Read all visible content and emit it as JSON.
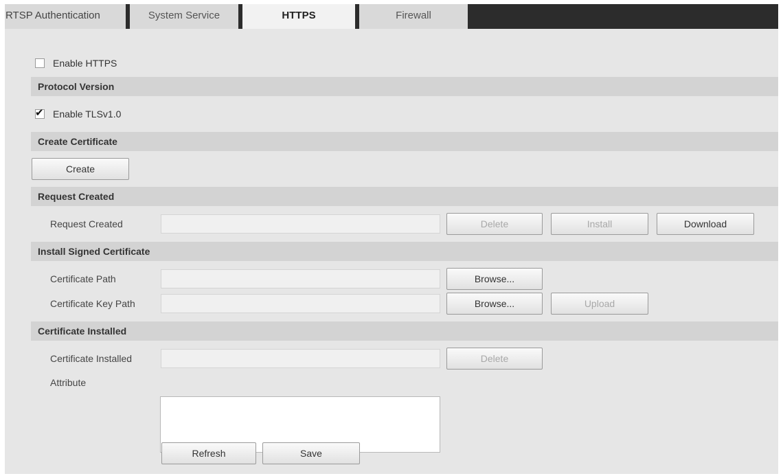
{
  "tabs": [
    {
      "label": "RTSP Authentication",
      "active": false
    },
    {
      "label": "System Service",
      "active": false
    },
    {
      "label": "HTTPS",
      "active": true
    },
    {
      "label": "Firewall",
      "active": false
    }
  ],
  "enable_https": {
    "label": "Enable HTTPS",
    "checked": false
  },
  "protocol_version": {
    "title": "Protocol Version",
    "tls": {
      "label": "Enable TLSv1.0",
      "checked": true
    }
  },
  "create_certificate": {
    "title": "Create Certificate",
    "create_label": "Create"
  },
  "request_created": {
    "title": "Request Created",
    "row_label": "Request Created",
    "value": "",
    "delete_label": "Delete",
    "install_label": "Install",
    "download_label": "Download"
  },
  "install_signed": {
    "title": "Install Signed Certificate",
    "cert_path_label": "Certificate Path",
    "cert_path_value": "",
    "cert_key_path_label": "Certificate Key Path",
    "cert_key_path_value": "",
    "browse_label": "Browse...",
    "upload_label": "Upload"
  },
  "cert_installed": {
    "title": "Certificate Installed",
    "row_label": "Certificate Installed",
    "value": "",
    "delete_label": "Delete",
    "attribute_label": "Attribute",
    "attribute_value": ""
  },
  "footer": {
    "refresh_label": "Refresh",
    "save_label": "Save"
  },
  "colors": {
    "tabbar": "#2c2c2c",
    "panel": "#e6e6e6",
    "section_header": "#d3d3d3",
    "disabled_text": "#a8a8a8"
  }
}
